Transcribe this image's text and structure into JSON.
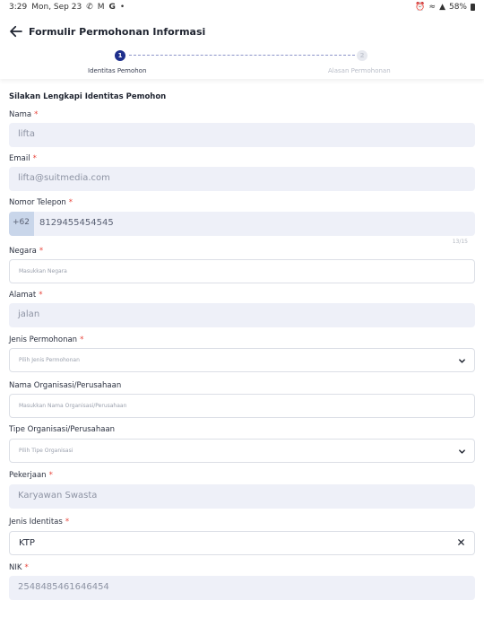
{
  "status_bar": {
    "time": "3:29",
    "date": "Mon, Sep 23",
    "battery": "58%",
    "left_icons": [
      "whatsapp-icon",
      "gmail-icon",
      "google-icon",
      "dot-icon"
    ],
    "right_icons": [
      "alarm-icon",
      "wifi-icon",
      "signal-icon",
      "battery-icon"
    ]
  },
  "header": {
    "title": "Formulir Permohonan Informasi"
  },
  "stepper": {
    "steps": [
      {
        "number": "1",
        "label": "Identitas Pemohon",
        "active": true
      },
      {
        "number": "2",
        "label": "Alasan Permohonan",
        "active": false
      }
    ]
  },
  "form": {
    "section_title": "Silakan Lengkapi Identitas Pemohon",
    "required_mark": "*",
    "nama": {
      "label": "Nama",
      "value": "lifta"
    },
    "email": {
      "label": "Email",
      "value": "lifta@suitmedia.com"
    },
    "telepon": {
      "label": "Nomor Telepon",
      "prefix": "+62",
      "value": "8129455454545",
      "counter": "13/15"
    },
    "negara": {
      "label": "Negara",
      "placeholder": "Masukkan Negara"
    },
    "alamat": {
      "label": "Alamat",
      "value": "jalan"
    },
    "jenis_permohonan": {
      "label": "Jenis Permohonan",
      "placeholder": "Pilih Jenis Permohonan"
    },
    "nama_organisasi": {
      "label": "Nama Organisasi/Perusahaan",
      "placeholder": "Masukkan Nama Organisasi/Perusahaan"
    },
    "tipe_organisasi": {
      "label": "Tipe Organisasi/Perusahaan",
      "placeholder": "Pilih Tipe Organisasi"
    },
    "pekerjaan": {
      "label": "Pekerjaan",
      "value": "Karyawan Swasta"
    },
    "jenis_identitas": {
      "label": "Jenis Identitas",
      "value": "KTP"
    },
    "nik": {
      "label": "NIK",
      "value": "2548485461646454"
    }
  },
  "colors": {
    "primary": "#1e2f8c",
    "required": "#e8453c",
    "filled_bg": "#eef0f8",
    "prefix_bg": "#c9d6ea"
  }
}
